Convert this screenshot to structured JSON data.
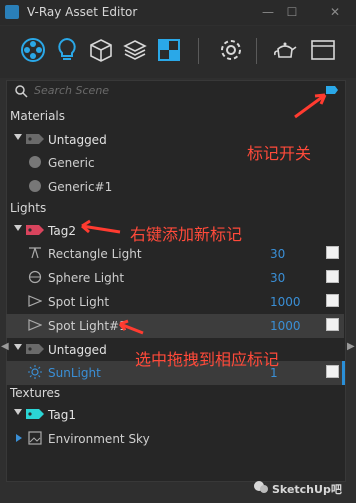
{
  "window": {
    "title": "V-Ray Asset Editor"
  },
  "search": {
    "placeholder": "Search Scene"
  },
  "sections": {
    "materials": "Materials",
    "lights": "Lights",
    "textures": "Textures"
  },
  "materials": {
    "tag": "Untagged",
    "items": [
      "Generic",
      "Generic#1"
    ]
  },
  "lights": {
    "tag2": "Tag2",
    "tag2_items": [
      {
        "name": "Rectangle Light",
        "value": "30"
      },
      {
        "name": "Sphere Light",
        "value": "30"
      },
      {
        "name": "Spot Light",
        "value": "1000"
      },
      {
        "name": "Spot Light#1",
        "value": "1000"
      }
    ],
    "untagged": "Untagged",
    "untagged_items": [
      {
        "name": "SunLight",
        "value": "1"
      }
    ]
  },
  "textures": {
    "tag": "Tag1",
    "items": [
      "Environment Sky"
    ]
  },
  "annotations": {
    "toggle": "标记开关",
    "add_tag": "右键添加新标记",
    "drag": "选中拖拽到相应标记"
  },
  "watermark": "SketchUp吧",
  "colors": {
    "accent": "#2a8fd8",
    "annotation": "#ff4a3a",
    "tag_teal": "#2bd6d6",
    "tag_red": "#d9445d"
  }
}
